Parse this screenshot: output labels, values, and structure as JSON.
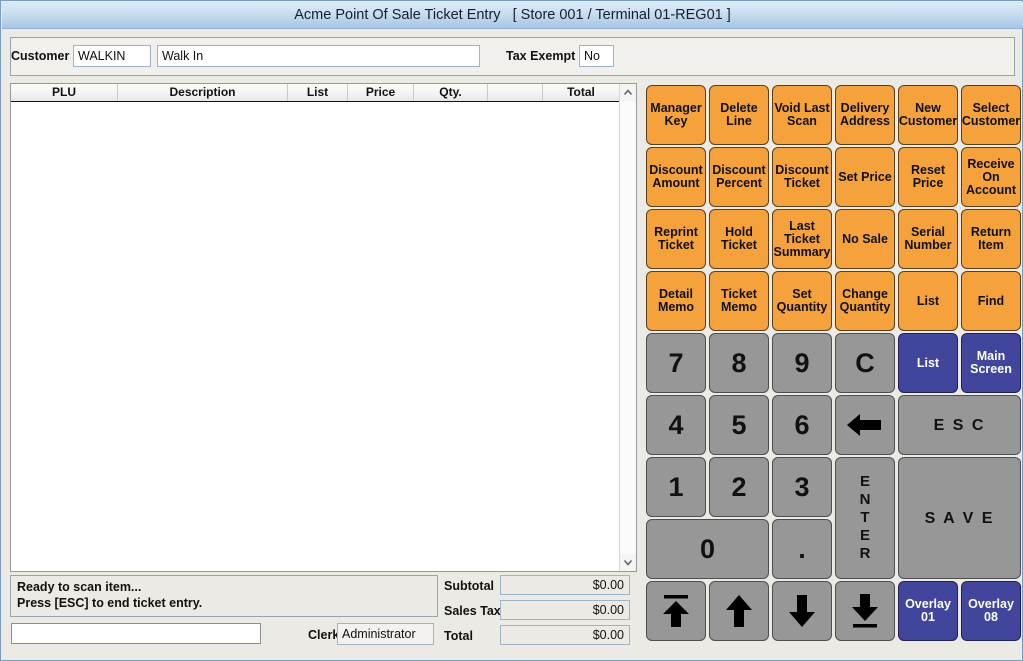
{
  "window": {
    "title": "Acme Point Of Sale Ticket Entry   [ Store 001 / Terminal 01-REG01 ]"
  },
  "customer_bar": {
    "customer_label": "Customer",
    "customer_code": "WALKIN",
    "customer_name": "Walk In",
    "tax_exempt_label": "Tax Exempt",
    "tax_exempt_value": "No"
  },
  "ticket_grid": {
    "columns": [
      "PLU",
      "Description",
      "List",
      "Price",
      "Qty.",
      "",
      "Total"
    ],
    "rows": [],
    "scrollbar": {
      "up_icon": "chevron-up-icon",
      "down_icon": "chevron-down-icon"
    }
  },
  "status": {
    "line1": "Ready to scan item...",
    "line2": "Press [ESC] to end ticket entry.",
    "scan_input_value": "",
    "clerk_label": "Clerk",
    "clerk_value": "Administrator"
  },
  "totals": {
    "subtotal_label": "Subtotal",
    "subtotal_value": "$0.00",
    "sales_tax_label": "Sales Tax",
    "sales_tax_value": "$0.00",
    "total_label": "Total",
    "total_value": "$0.00"
  },
  "function_keys": [
    {
      "line1": "Manager",
      "line2": "Key"
    },
    {
      "line1": "Delete",
      "line2": "Line"
    },
    {
      "line1": "Void Last",
      "line2": "Scan"
    },
    {
      "line1": "Delivery",
      "line2": "Address"
    },
    {
      "line1": "New",
      "line2": "Customer"
    },
    {
      "line1": "Select",
      "line2": "Customer"
    },
    {
      "line1": "Discount",
      "line2": "Amount"
    },
    {
      "line1": "Discount",
      "line2": "Percent"
    },
    {
      "line1": "Discount",
      "line2": "Ticket"
    },
    {
      "line1": "Set Price",
      "line2": ""
    },
    {
      "line1": "Reset",
      "line2": "Price"
    },
    {
      "line1": "Receive",
      "line2": "On",
      "line3": "Account"
    },
    {
      "line1": "Reprint",
      "line2": "Ticket"
    },
    {
      "line1": "Hold",
      "line2": "Ticket"
    },
    {
      "line1": "Last",
      "line2": "Ticket",
      "line3": "Summary"
    },
    {
      "line1": "No Sale",
      "line2": ""
    },
    {
      "line1": "Serial",
      "line2": "Number"
    },
    {
      "line1": "Return",
      "line2": "Item"
    },
    {
      "line1": "Detail",
      "line2": "Memo"
    },
    {
      "line1": "Ticket",
      "line2": "Memo"
    },
    {
      "line1": "Set",
      "line2": "Quantity"
    },
    {
      "line1": "Change",
      "line2": "Quantity"
    },
    {
      "line1": "List",
      "line2": ""
    },
    {
      "line1": "Find",
      "line2": ""
    }
  ],
  "keypad": {
    "digit_7": "7",
    "digit_8": "8",
    "digit_9": "9",
    "clear": "C",
    "digit_4": "4",
    "digit_5": "5",
    "digit_6": "6",
    "backspace_icon": "backspace-arrow-icon",
    "escape": "E S C",
    "digit_1": "1",
    "digit_2": "2",
    "digit_3": "3",
    "enter": "ENTER",
    "save": "S A V E",
    "digit_0": "0",
    "decimal": ".",
    "list_blue": "List",
    "main_screen_line1": "Main",
    "main_screen_line2": "Screen",
    "scroll_top_icon": "arrow-to-top-icon",
    "scroll_up_icon": "arrow-up-icon",
    "scroll_down_icon": "arrow-down-icon",
    "scroll_bottom_icon": "arrow-to-bottom-icon",
    "overlay01_line1": "Overlay",
    "overlay01_line2": "01",
    "overlay08_line1": "Overlay",
    "overlay08_line2": "08"
  },
  "colors": {
    "function_key": "#F5A23C",
    "keypad_key": "#979797",
    "accent_blue": "#41459B",
    "titlebar": "#B6D0EA"
  }
}
